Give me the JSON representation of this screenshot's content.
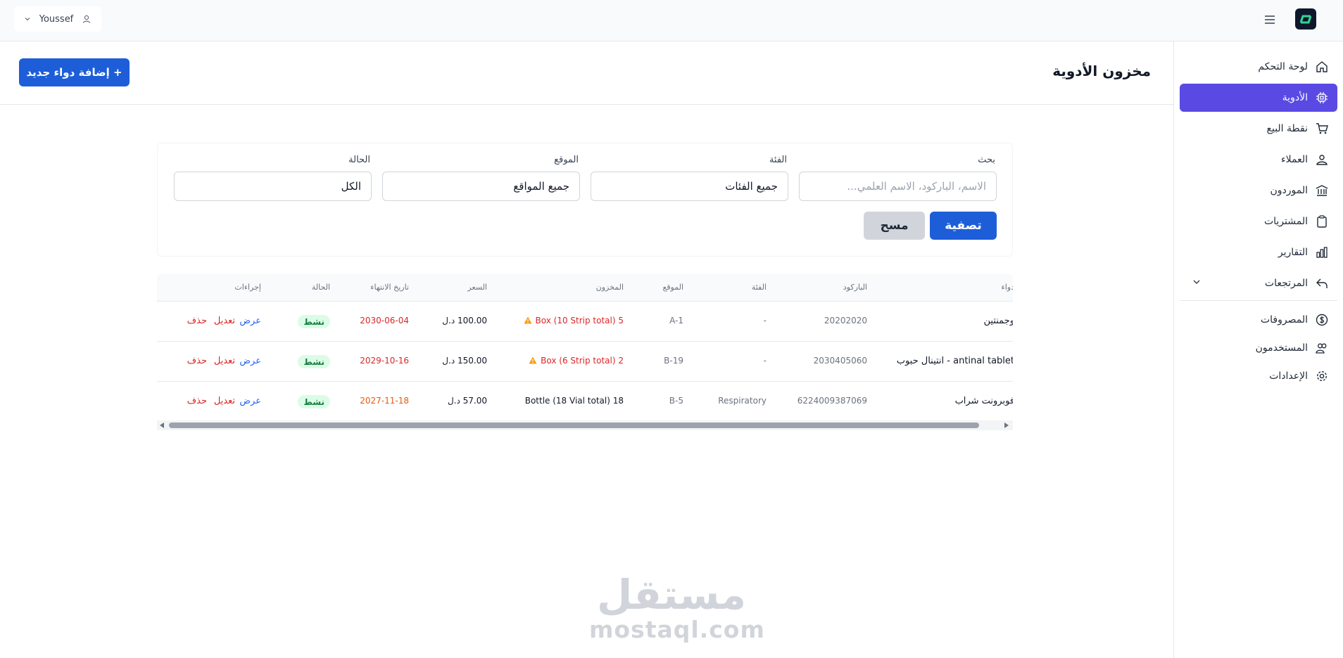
{
  "topbar": {
    "user_name": "Youssef"
  },
  "sidebar": {
    "items": [
      {
        "label": "لوحة التحكم",
        "icon": "home-icon"
      },
      {
        "label": "الأدوية",
        "icon": "pill-icon"
      },
      {
        "label": "نقطة البيع",
        "icon": "cart-icon"
      },
      {
        "label": "العملاء",
        "icon": "users-icon"
      },
      {
        "label": "الموردون",
        "icon": "building-icon"
      },
      {
        "label": "المشتريات",
        "icon": "clipboard-icon"
      },
      {
        "label": "التقارير",
        "icon": "chart-icon"
      },
      {
        "label": "المرتجعات",
        "icon": "return-icon"
      },
      {
        "label": "المصروفات",
        "icon": "dollar-icon"
      },
      {
        "label": "المستخدمون",
        "icon": "user-group-icon"
      },
      {
        "label": "الإعدادات",
        "icon": "gear-icon"
      }
    ],
    "active_index": 1
  },
  "page": {
    "title": "مخزون الأدوية",
    "add_button": "+ إضافة دواء جديد"
  },
  "filters": {
    "search_label": "بحث",
    "search_placeholder": "الاسم، الباركود، الاسم العلمي...",
    "category_label": "الفئة",
    "category_value": "جميع الفئات",
    "location_label": "الموقع",
    "location_value": "جميع المواقع",
    "status_label": "الحالة",
    "status_value": "الكل",
    "filter_button": "تصفية",
    "clear_button": "مسح"
  },
  "table": {
    "headers": {
      "name": "دواء",
      "barcode": "الباركود",
      "category": "الفئة",
      "location": "الموقع",
      "stock": "المخزون",
      "price": "السعر",
      "expiry": "تاريخ الانتهاء",
      "status": "الحالة",
      "actions": "إجراءات"
    },
    "actions": {
      "view": "عرض",
      "edit": "تعديل",
      "delete": "حذف"
    },
    "rows": [
      {
        "name": "وجمنتين",
        "barcode": "20202020",
        "category": "-",
        "location": "A-1",
        "stock": "Box (10 Strip total) 5",
        "price": "100.00 د.ل",
        "expiry": "2030-06-04",
        "status": "نشط"
      },
      {
        "name": "antinal tablet - انتينال حبوب",
        "barcode": "2030405060",
        "category": "-",
        "location": "B-19",
        "stock": "Box (6 Strip total) 2",
        "price": "150.00 د.ل",
        "expiry": "2029-10-16",
        "status": "نشط"
      },
      {
        "name": "فوبرونت شراب",
        "barcode": "6224009387069",
        "category": "Respiratory",
        "location": "B-5",
        "stock": "Bottle (18 Vial total) 18",
        "price": "57.00 د.ل",
        "expiry": "2027-11-18",
        "status": "نشط"
      }
    ]
  },
  "watermark": {
    "arabic": "مستقل",
    "latin": "mostaql.com"
  },
  "colors": {
    "primary": "#1d5ed8",
    "sidebar_active": "#5a4ae3",
    "danger": "#dc2626",
    "success_bg": "#dcfce7",
    "success_text": "#15803d"
  }
}
